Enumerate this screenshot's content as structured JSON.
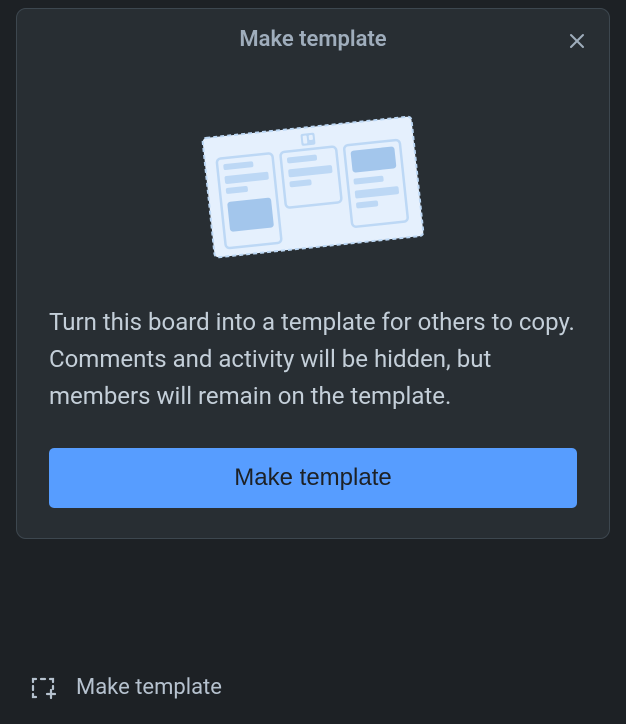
{
  "modal": {
    "title": "Make template",
    "description": "Turn this board into a template for others to copy. Comments and activity will be hidden, but members will remain on the template.",
    "primary_button_label": "Make template"
  },
  "secondary": {
    "label": "Make template"
  },
  "colors": {
    "accent": "#579dff",
    "bg": "#1d2125",
    "panel": "#282e33",
    "text": "#b6c2cf",
    "illustration_light": "#e5f0fd",
    "illustration_mid": "#bdd8f5",
    "illustration_dark": "#a3c6ec"
  }
}
